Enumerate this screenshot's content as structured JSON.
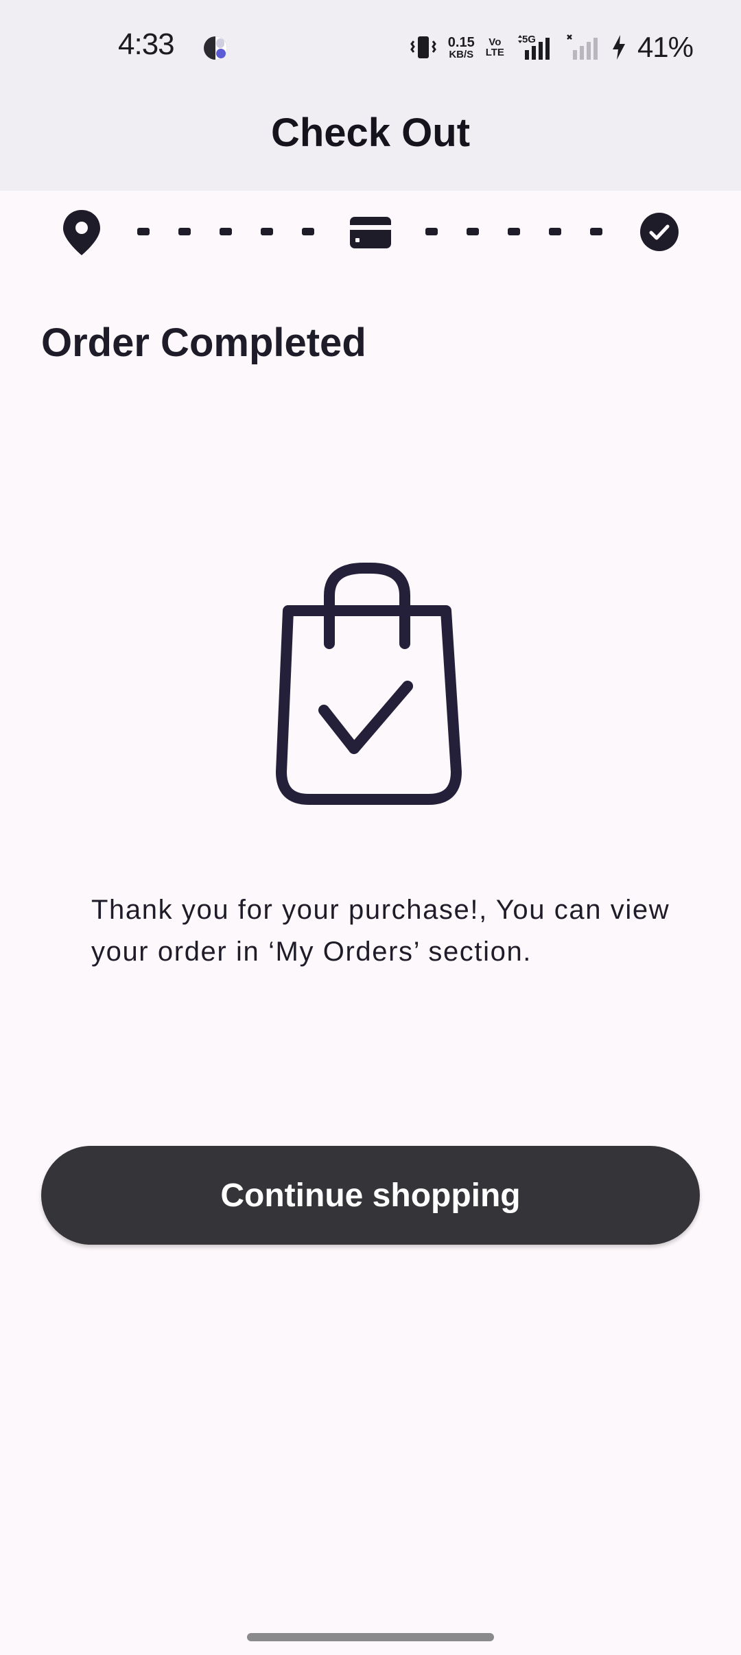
{
  "status_bar": {
    "time": "4:33",
    "net_speed_value": "0.15",
    "net_speed_unit": "KB/S",
    "volte_top": "Vo",
    "volte_bottom": "LTE",
    "network_type": "5G",
    "battery_percent": "41%"
  },
  "header": {
    "title": "Check Out"
  },
  "stepper": {
    "steps": [
      {
        "name": "address",
        "icon": "location-pin-icon",
        "state": "done"
      },
      {
        "name": "payment",
        "icon": "credit-card-icon",
        "state": "done"
      },
      {
        "name": "confirmation",
        "icon": "check-circle-icon",
        "state": "current"
      }
    ]
  },
  "main": {
    "heading": "Order Completed",
    "illustration_icon": "shopping-bag-check-icon",
    "message": "Thank you for your purchase!, You can view your order in ‘My Orders’ section.",
    "button_label": "Continue shopping"
  },
  "colors": {
    "background": "#fdf8fb",
    "app_bar": "#f1eef3",
    "ink": "#1e1c28",
    "button": "#353438",
    "button_text": "#ffffff"
  }
}
